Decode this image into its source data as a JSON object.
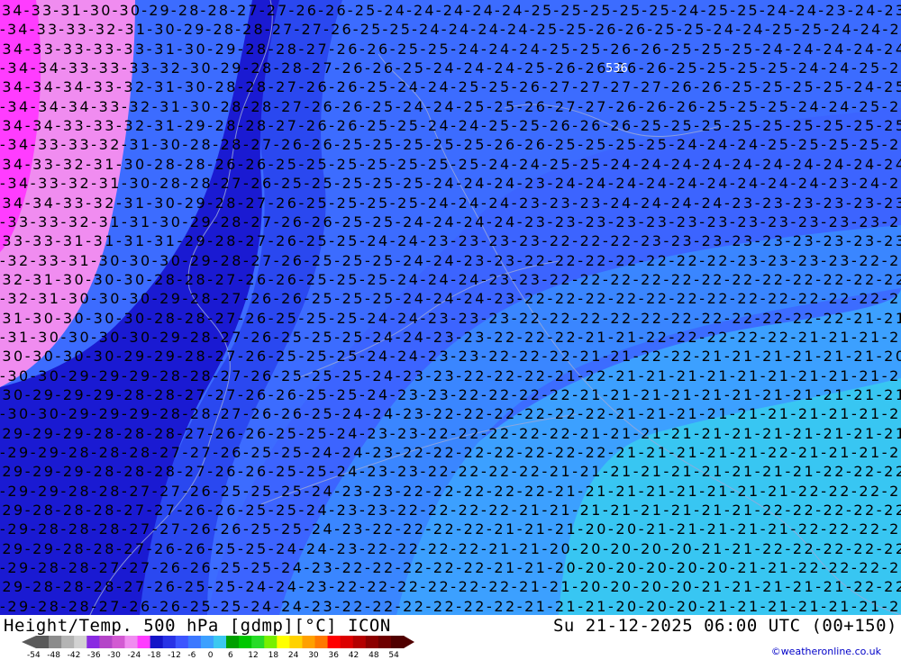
{
  "header": {
    "title": "Height/Temp. 500 hPa [gdmp][°C] ICON",
    "valid_time": "Su 21-12-2025 06:00 UTC (00+150)"
  },
  "credit": "©weatheronline.co.uk",
  "colorbar": {
    "ticks": [
      "-54",
      "-48",
      "-42",
      "-36",
      "-30",
      "-24",
      "-18",
      "-12",
      "-6",
      "0",
      "6",
      "12",
      "18",
      "24",
      "30",
      "36",
      "42",
      "48",
      "54"
    ],
    "colors": [
      "#5a5a5a",
      "#8c8c8c",
      "#b4b4b4",
      "#d2d2d2",
      "#8a2be2",
      "#b445c8",
      "#d25ad2",
      "#f08cf0",
      "#ff3cff",
      "#1414c8",
      "#2832e6",
      "#3c55ff",
      "#3c78ff",
      "#3ca0ff",
      "#3cc8f0",
      "#00a000",
      "#00c800",
      "#28dc28",
      "#78f000",
      "#ffff00",
      "#ffd200",
      "#ffa000",
      "#ff7800",
      "#ff0000",
      "#dc0000",
      "#b40000",
      "#8c0000",
      "#6e0000",
      "#500000"
    ]
  },
  "map": {
    "zones": [
      {
        "name": "-34",
        "color": "#ff3cff"
      },
      {
        "name": "-32",
        "color": "#f08cf0"
      },
      {
        "name": "-30",
        "color": "#1414c8"
      },
      {
        "name": "-27",
        "color": "#2832e6"
      },
      {
        "name": "-24",
        "color": "#3c55ff"
      },
      {
        "name": "-22",
        "color": "#3c78ff"
      },
      {
        "name": "-21",
        "color": "#3ca0ff"
      },
      {
        "name": "-20",
        "color": "#3cc8f0"
      }
    ],
    "label_color": "#000000",
    "height_contour": "536",
    "rows": [
      "-34-33-31-30-30-29-28-28-27-27-26-26-25-24-24-24-24-24-25-25-25-25-25-24-25-25-24-24-23-24-23",
      "-34-33-33-32-31-30-29-28-28-27-27-26-25-25-24-24-24-24-25-25-26-26-25-25-24-24-25-25-24-24-23",
      "-34-33-33-33-33-31-30-29-28-28-27-26-26-25-25-24-24-24-25-25-26-26-25-25-25-24-24-24-24-24",
      "-34-34-33-33-33-32-30-29-28-28-27-26-26-25-24-24-24-25-26-26-26-26-25-25-25-25-24-24-25-25",
      "-34-34-34-33-32-31-30-28-28-27-26-26-25-24-24-25-25-26-27-27-27-27-26-26-25-25-25-25-24-25",
      "-34-34-34-33-32-31-30-28-28-27-26-26-25-24-24-25-25-26-27-27-26-26-26-25-25-25-24-24-25-25",
      "-34-34-33-33-32-31-29-28-28-27-26-26-25-25-24-24-25-25-26-26-26-25-25-25-25-25-25-25-25-25",
      "-34-33-33-32-31-30-28-28-27-26-26-25-25-25-25-25-26-26-25-25-25-25-24-24-24-25-25-25-25-25",
      "-34-33-32-31-30-28-28-26-26-25-25-25-25-25-25-25-24-24-25-25-24-24-24-24-24-24-24-24-24-24",
      "-34-33-32-31-30-28-28-27-26-25-25-25-25-25-24-24-24-23-24-24-24-24-24-24-24-24-24-23-24-24",
      "-34-34-33-32-31-30-29-28-27-26-25-25-25-25-24-24-24-23-23-23-24-24-24-24-23-23-23-23-23-23",
      "-33-33-32-31-31-30-29-28-27-26-26-25-25-24-24-24-24-23-23-23-23-23-23-23-23-23-23-23-23-23",
      "-33-33-31-31-31-31-29-28-27-26-25-25-24-24-23-23-23-23-22-22-22-23-23-23-23-23-23-23-23-23",
      "-32-33-31-30-30-30-29-28-27-26-25-25-25-24-24-23-23-22-22-22-22-22-22-22-23-23-23-23-22-22",
      "-32-31-30-30-30-28-28-27-26-26-25-25-25-24-24-24-23-23-22-22-22-22-22-22-22-22-22-22-22-22",
      "-32-31-30-30-30-29-28-27-26-26-25-25-25-24-24-24-23-22-22-22-22-22-22-22-22-22-22-22-22-21",
      "-31-30-30-30-30-28-28-27-26-25-25-25-24-24-23-23-23-22-22-22-22-22-22-22-22-22-22-22-21-21",
      "-31-30-30-30-30-29-28-27-26-25-25-25-24-24-23-23-22-22-22-21-21-22-22-22-22-22-21-21-21-21",
      "-30-30-30-30-29-29-28-27-26-25-25-25-24-24-23-23-22-22-22-21-21-22-22-21-21-21-21-21-21-20",
      "-30-30-29-29-29-28-28-27-26-25-25-25-24-23-23-22-22-22-21-22-21-21-21-21-21-21-21-21-21-21",
      "-30-29-29-29-28-28-27-27-26-26-25-25-24-23-23-22-22-22-22-21-21-21-21-21-21-21-21-21-21-21",
      "-30-30-29-29-29-28-28-27-26-26-25-24-24-23-22-22-22-22-22-22-21-21-21-21-21-21-21-21-21-21",
      "-29-29-29-28-28-28-27-26-26-25-25-24-23-23-22-22-22-22-22-21-21-21-21-21-21-21-21-21-21-21",
      "-29-29-28-28-28-27-27-26-25-25-24-24-23-22-22-22-22-22-22-22-21-21-21-21-21-22-21-21-21-21",
      "-29-29-29-28-28-28-27-26-26-25-25-24-23-23-22-22-22-22-21-21-21-21-21-21-21-21-21-22-22-22",
      "-29-29-28-28-27-27-26-25-25-25-24-23-23-22-22-22-22-22-21-21-21-21-21-21-21-21-22-22-22-22",
      "-29-28-28-28-27-27-26-26-25-25-24-23-23-22-22-22-22-21-21-21-21-21-21-21-21-22-22-22-22-22",
      "-29-28-28-28-27-27-26-26-25-25-24-23-22-22-22-22-21-21-21-20-20-21-21-21-21-21-22-22-22-22",
      "-29-29-28-28-27-26-26-25-25-24-24-23-22-22-22-22-21-21-20-20-20-20-20-21-21-22-22-22-22-22",
      "-29-28-28-27-27-26-26-25-25-24-23-22-22-22-22-22-21-21-20-20-20-20-20-20-21-21-22-22-22-22",
      "-29-28-28-28-27-26-25-25-24-24-23-22-22-22-22-22-22-21-21-20-20-20-20-21-21-21-21-21-22-22",
      "-29-28-28-27-26-26-25-25-24-24-23-22-22-22-22-22-22-21-21-21-20-20-20-21-21-21-21-21-21-22"
    ]
  }
}
